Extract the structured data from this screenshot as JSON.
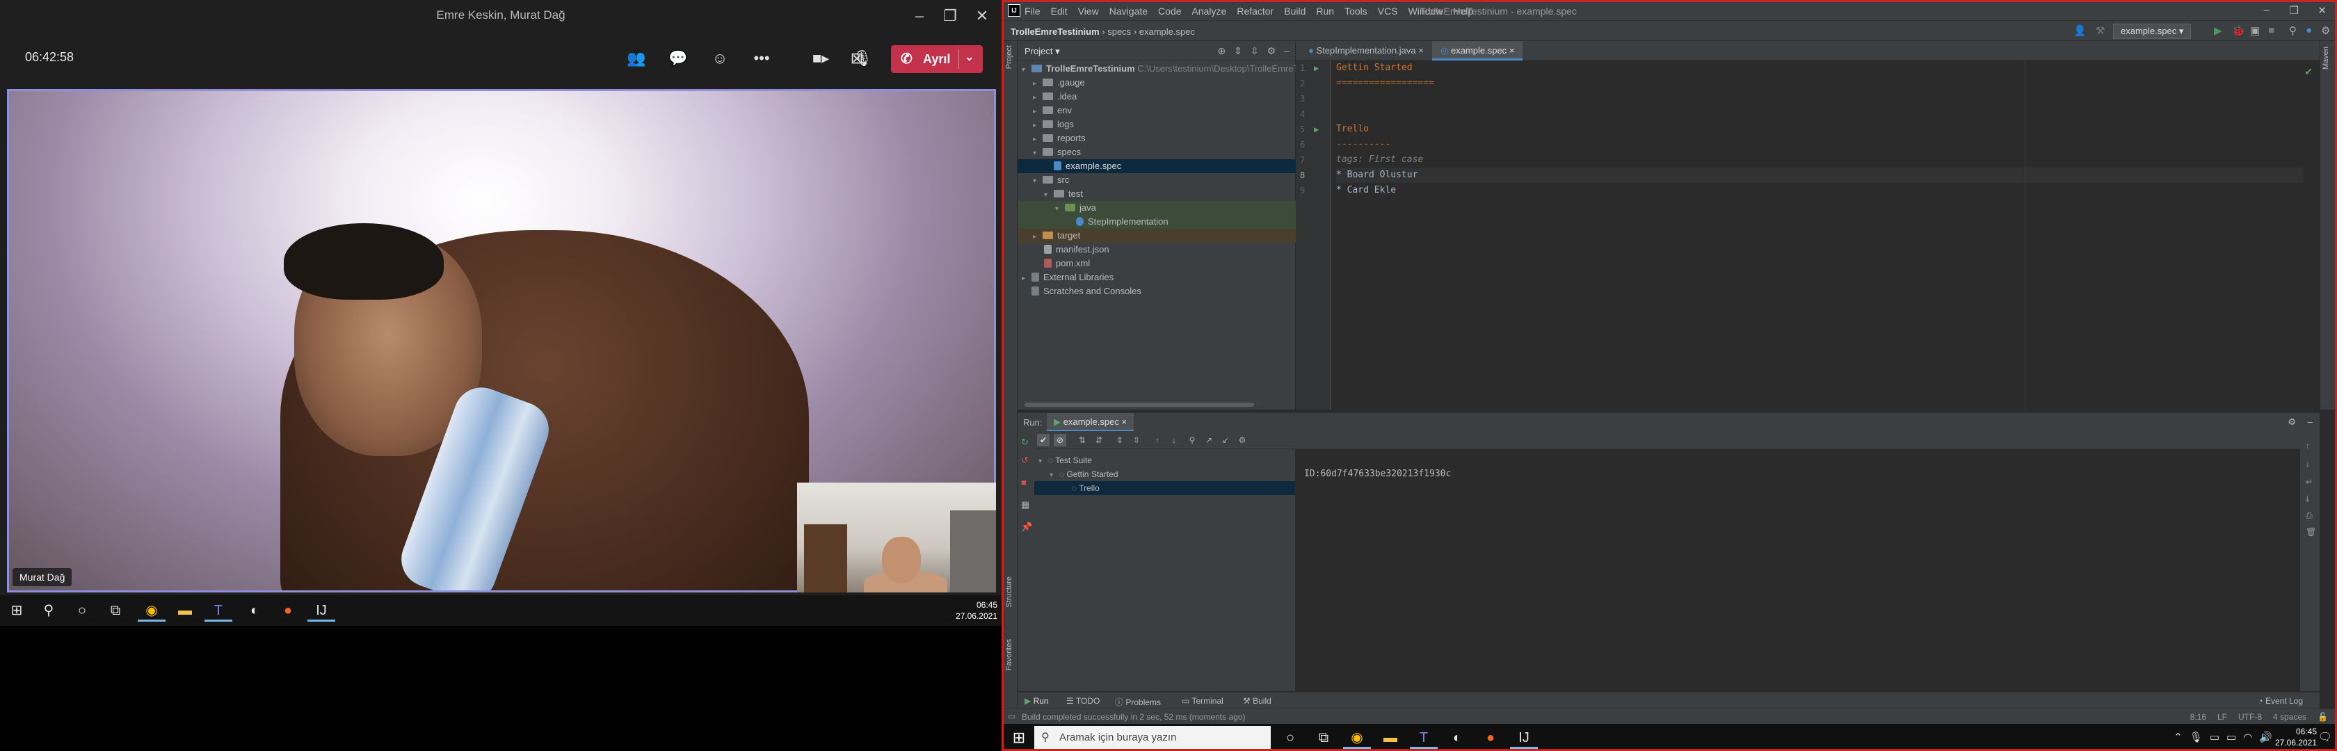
{
  "teams": {
    "window_title": "Emre Keskin, Murat Dağ",
    "call_timer": "06:42:58",
    "leave_label": "Ayrıl",
    "participant_name": "Murat Dağ",
    "icons": [
      "participants-icon",
      "chat-icon",
      "reactions-icon",
      "more-icon",
      "camera-icon",
      "mic-icon",
      "share-icon",
      "phone-icon"
    ]
  },
  "left_taskbar": {
    "time": "06:45",
    "date": "27.06.2021"
  },
  "ide": {
    "menu": [
      "File",
      "Edit",
      "View",
      "Navigate",
      "Code",
      "Analyze",
      "Refactor",
      "Build",
      "Run",
      "Tools",
      "VCS",
      "Window",
      "Help"
    ],
    "title": "TrolleEmreTestinium - example.spec",
    "breadcrumb": {
      "project": "TrolleEmreTestinium",
      "folder": "specs",
      "file": "example.spec"
    },
    "run_config": "example.spec",
    "project_panel_title": "Project",
    "tree": [
      {
        "label": "TrolleEmreTestinium",
        "path": "C:\\Users\\testinium\\Desktop\\TrolleEmreTe"
      },
      {
        "label": ".gauge"
      },
      {
        "label": ".idea"
      },
      {
        "label": "env"
      },
      {
        "label": "logs"
      },
      {
        "label": "reports"
      },
      {
        "label": "specs"
      },
      {
        "label": "example.spec"
      },
      {
        "label": "src"
      },
      {
        "label": "test"
      },
      {
        "label": "java"
      },
      {
        "label": "StepImplementation"
      },
      {
        "label": "target"
      },
      {
        "label": "manifest.json"
      },
      {
        "label": "pom.xml"
      },
      {
        "label": "External Libraries"
      },
      {
        "label": "Scratches and Consoles"
      }
    ],
    "tabs": [
      "StepImplementation.java",
      "example.spec"
    ],
    "code_lines": [
      {
        "n": "1",
        "text": "Gettin Started"
      },
      {
        "n": "2",
        "text": "=================="
      },
      {
        "n": "3",
        "text": ""
      },
      {
        "n": "4",
        "text": ""
      },
      {
        "n": "5",
        "text": "Trello"
      },
      {
        "n": "6",
        "text": "----------"
      },
      {
        "n": "7",
        "text": "tags: First case"
      },
      {
        "n": "8",
        "text": "* Board Olustur"
      },
      {
        "n": "9",
        "text": "* Card Ekle"
      }
    ],
    "run": {
      "label": "Run:",
      "tab": "example.spec",
      "tree": [
        "Test Suite",
        "Gettin Started",
        "Trello"
      ],
      "console": "ID:60d7f47633be320213f1930c"
    },
    "side_labels": [
      "Project",
      "Structure",
      "Favorites",
      "Maven"
    ],
    "bottom_tabs": [
      "Run",
      "TODO",
      "Problems",
      "Terminal",
      "Build",
      "Event Log"
    ],
    "status_message": "Build completed successfully in 2 sec, 52 ms (moments ago)",
    "status_right": [
      "8:16",
      "LF",
      "UTF-8",
      "4 spaces"
    ]
  },
  "right_taskbar": {
    "search_placeholder": "Aramak için buraya yazın",
    "time": "06:45",
    "date": "27.06.2021"
  },
  "colors": {
    "teams_leave": "#c4314b",
    "teams_video_border": "#8f8fdb",
    "ide_border": "#c8241f",
    "ide_bg": "#2b2b2b",
    "spec_heading": "#cc7832"
  }
}
